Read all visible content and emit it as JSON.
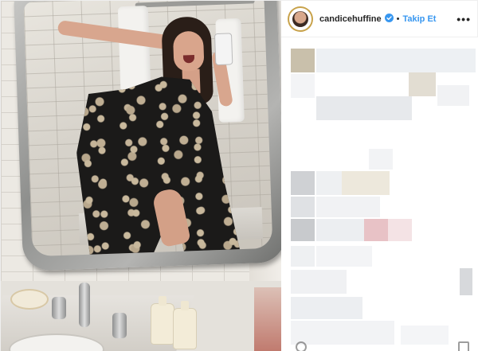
{
  "post": {
    "username": "candicehuffine",
    "separator": "•",
    "follow_label": "Takip Et",
    "more_label": "•••"
  },
  "icons": {
    "verified": "verified-badge-icon",
    "more": "more-options-icon",
    "avatar": "profile-avatar"
  },
  "colors": {
    "follow_blue": "#3897f0",
    "verified_blue": "#3897f0",
    "text_dark": "#262626",
    "border": "#efefef",
    "blur_accent_red": "#e8c2c6",
    "blur_accent_beige": "#e2ddd2"
  },
  "comments_state": "blurred"
}
